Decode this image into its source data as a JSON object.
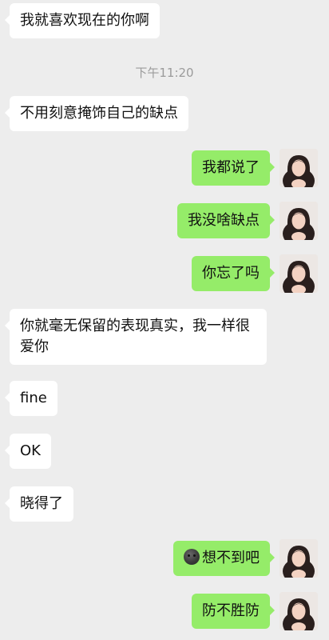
{
  "timestamp": "下午11:20",
  "messages": [
    {
      "id": "m1",
      "side": "in",
      "text": "我就喜欢现在的你啊"
    },
    {
      "id": "m2",
      "side": "in",
      "text": "不用刻意掩饰自己的缺点"
    },
    {
      "id": "m3",
      "side": "out",
      "text": "我都说了"
    },
    {
      "id": "m4",
      "side": "out",
      "text": "我没啥缺点"
    },
    {
      "id": "m5",
      "side": "out",
      "text": "你忘了吗"
    },
    {
      "id": "m6",
      "side": "in",
      "text": "你就毫无保留的表现真实，我一样很爱你"
    },
    {
      "id": "m7",
      "side": "in",
      "text": "fine"
    },
    {
      "id": "m8",
      "side": "in",
      "text": "OK"
    },
    {
      "id": "m9",
      "side": "in",
      "text": "晓得了"
    },
    {
      "id": "m10",
      "side": "out",
      "emoji": "new-moon-face-emoji",
      "text": "想不到吧"
    },
    {
      "id": "m11",
      "side": "out",
      "text": "防不胜防"
    }
  ],
  "colors": {
    "background": "#ededed",
    "incoming_bubble": "#ffffff",
    "outgoing_bubble": "#95ec69",
    "timestamp_text": "#9b9b9b"
  },
  "icons": {
    "avatar": "user-avatar-icon",
    "emoji": "new-moon-face-emoji"
  }
}
